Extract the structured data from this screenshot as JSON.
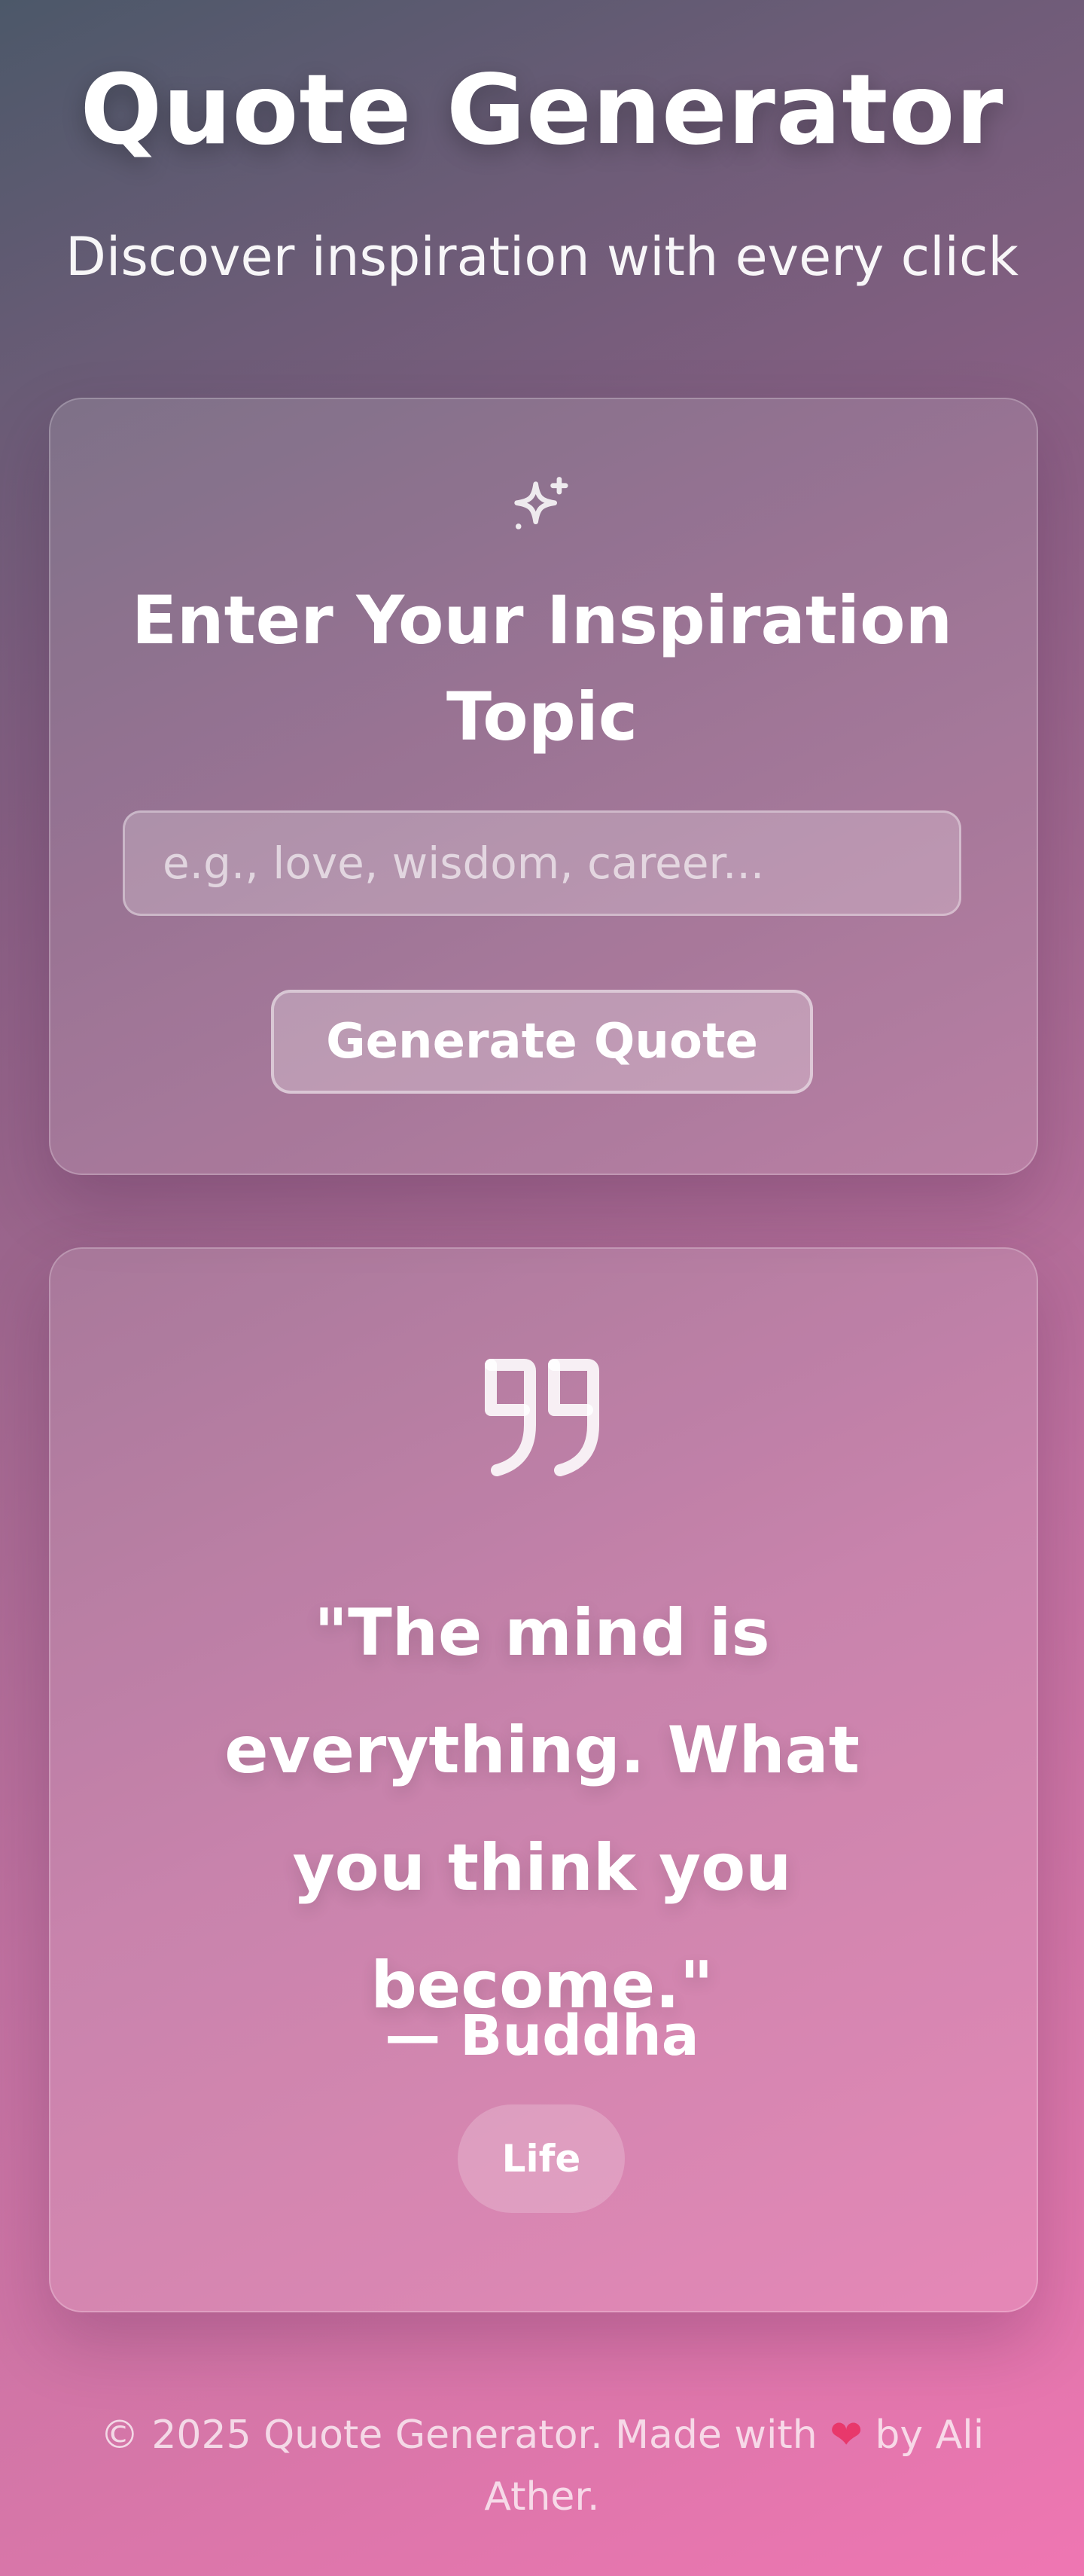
{
  "header": {
    "title": "Quote Generator",
    "subtitle": "Discover inspiration with every click"
  },
  "input_card": {
    "icon": "sparkles-icon",
    "heading": "Enter Your Inspiration Topic",
    "input_placeholder": "e.g., love, wisdom, career...",
    "input_value": "",
    "button_label": "Generate Quote"
  },
  "quote_card": {
    "icon": "quote-icon",
    "quote": "\"The mind is everything. What you think you become.\"",
    "author": "— Buddha",
    "tag": "Life"
  },
  "footer": {
    "text_before": "© 2025 Quote Generator. Made with",
    "heart": "❤",
    "text_after": "by Ali Ather."
  },
  "colors": {
    "gradient_start": "#4c5869",
    "gradient_end": "#ef76b2",
    "heart": "#e8386b"
  }
}
